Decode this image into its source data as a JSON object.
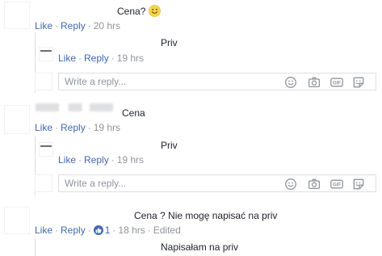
{
  "actions": {
    "like": "Like",
    "reply": "Reply",
    "separator": "·"
  },
  "comments": [
    {
      "text": "Cena?",
      "emoji": "smiley-emoji",
      "time": "20 hrs"
    },
    {
      "text": "Priv",
      "time": "19 hrs"
    },
    {
      "text": "Cena",
      "time": "19 hrs"
    },
    {
      "text": "Priv",
      "time": "19 hrs"
    },
    {
      "text": "Cena ? Nie mogę napisać na priv",
      "reaction_count": "1",
      "time": "18 hrs",
      "edited": "Edited"
    },
    {
      "text": "Napisałam na priv"
    }
  ],
  "reply_input": {
    "placeholder": "Write a reply..."
  },
  "reply_input_icons": [
    "emoji-icon",
    "camera-icon",
    "gif-icon",
    "sticker-icon"
  ],
  "colors": {
    "link": "#4267b2",
    "meta": "#90949c",
    "text": "#1d2129",
    "border": "#dddfe2"
  }
}
